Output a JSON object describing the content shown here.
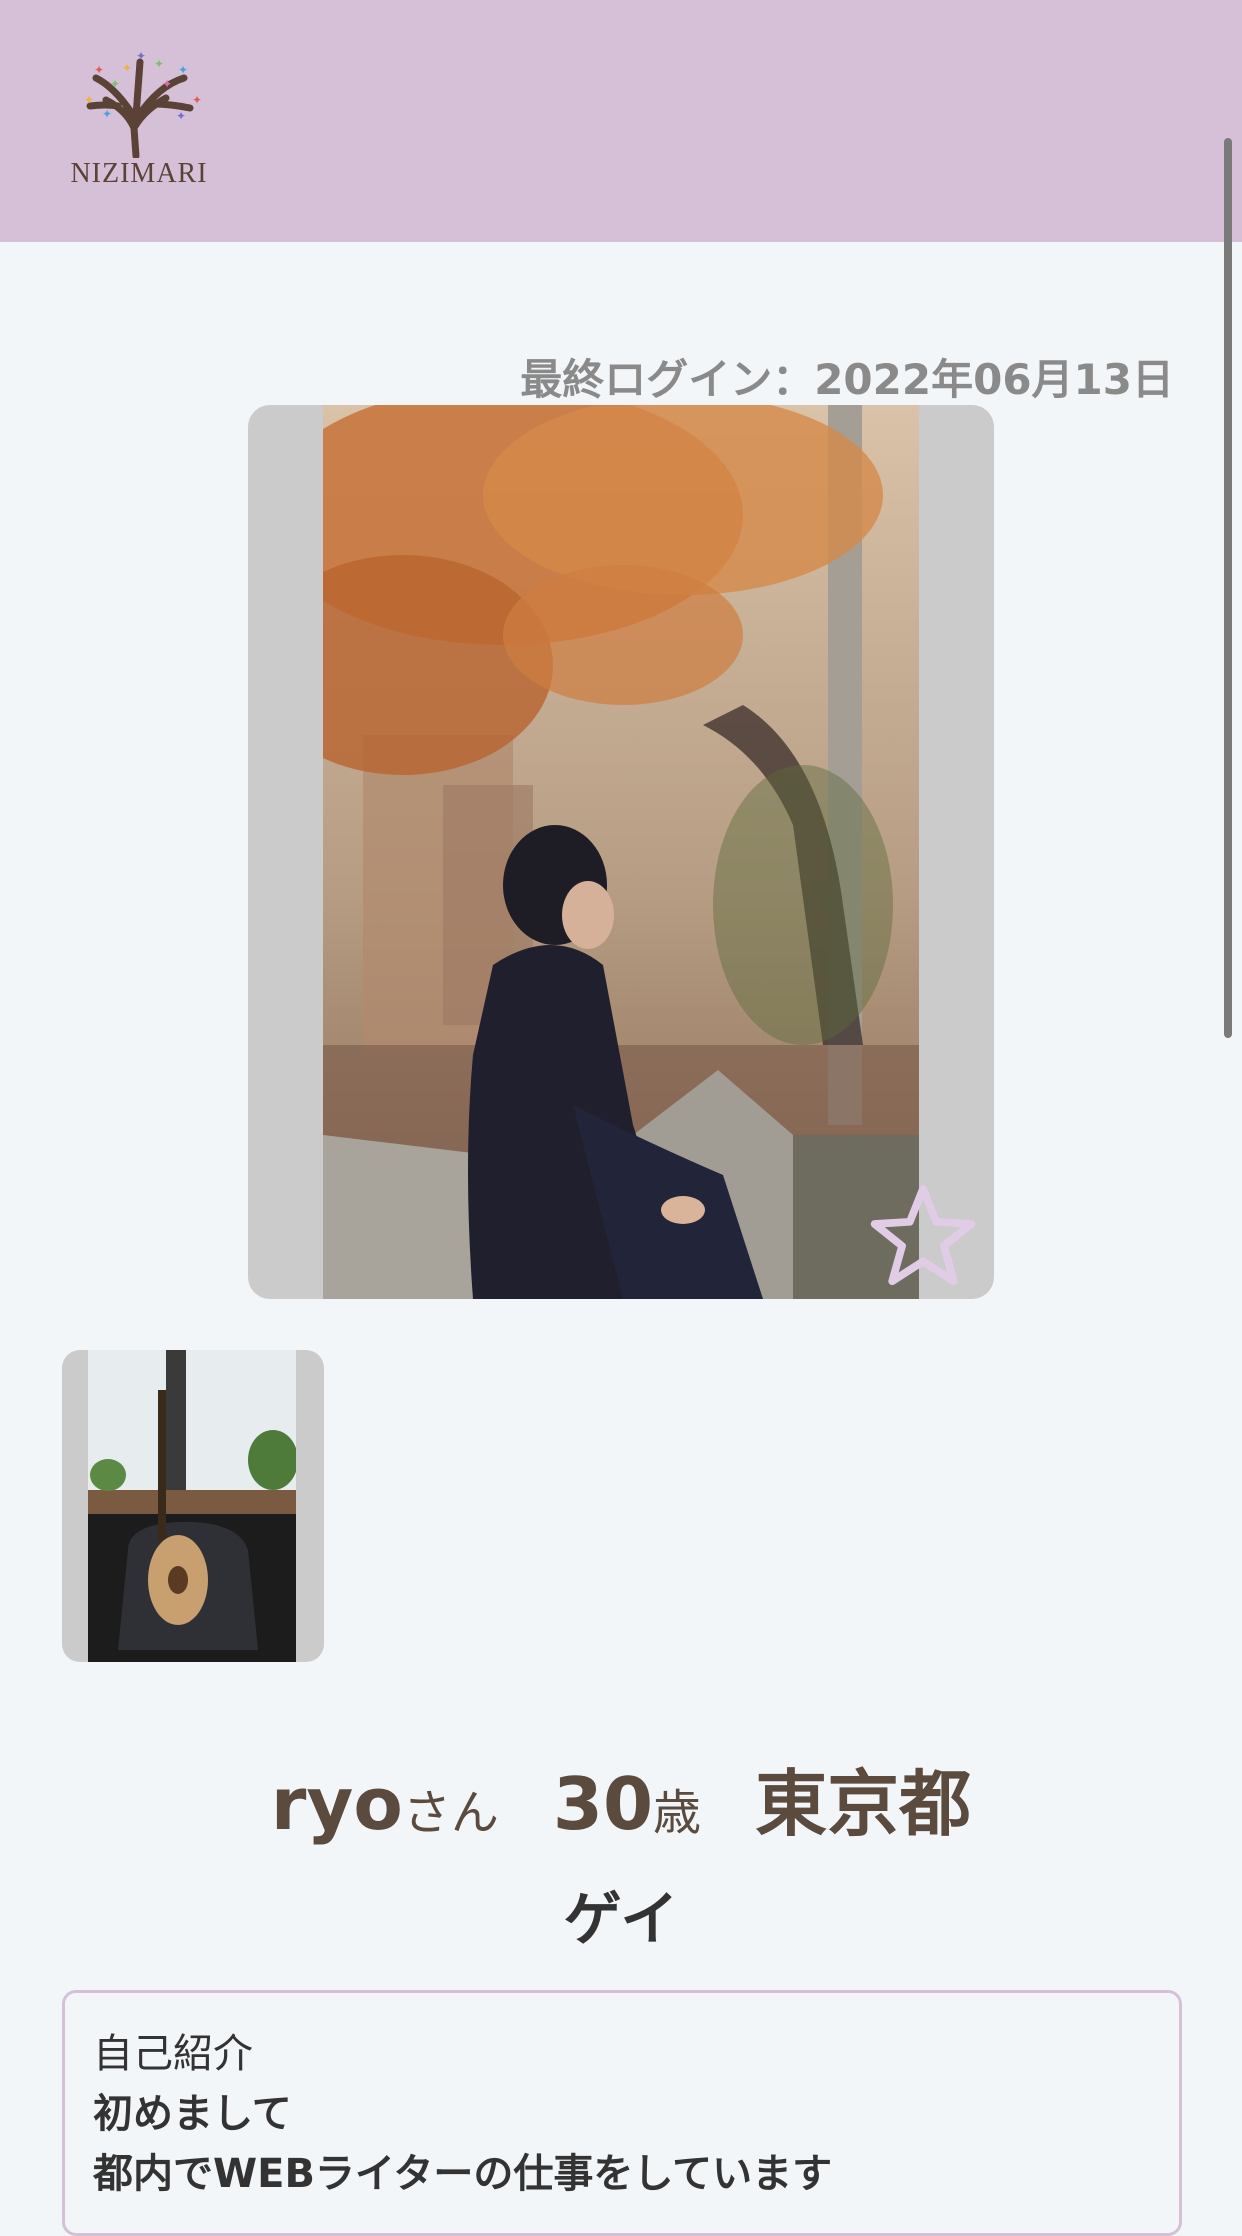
{
  "header": {
    "brand": "NIZIMARI",
    "background": "#d5c0d8"
  },
  "profile": {
    "last_login": "最終ログイン：2022年06月13日",
    "name": "ryo",
    "name_suffix": "さん",
    "age": "30",
    "age_suffix": "歳",
    "location": "東京都",
    "orientation": "ゲイ"
  },
  "photos": {
    "main": "man-in-autumn-park-photo",
    "thumbnails": [
      "bass-guitar-on-chair-photo"
    ]
  },
  "icons": {
    "favorite": "star-outline-icon",
    "favorite_color": "#e1cce6"
  },
  "intro": {
    "title": "自己紹介",
    "lines": [
      "初めまして",
      "都内でWEBライターの仕事をしています"
    ]
  }
}
